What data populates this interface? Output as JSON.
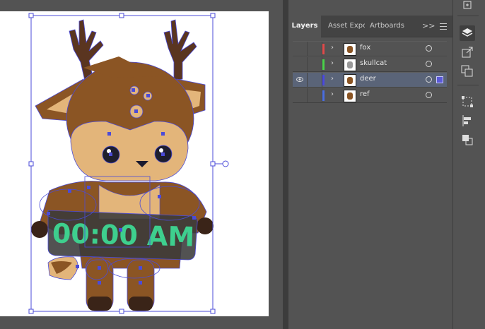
{
  "panel": {
    "tabs": [
      {
        "label": "Layers"
      },
      {
        "label": "Asset Expo"
      },
      {
        "label": "Artboards"
      }
    ],
    "more_label": ">>"
  },
  "layers": [
    {
      "name": "fox",
      "color": "#e04a4a",
      "visible": false,
      "selected": false
    },
    {
      "name": "skullcat",
      "color": "#4ad24a",
      "visible": false,
      "selected": false
    },
    {
      "name": "deer",
      "color": "#4a4ae0",
      "visible": true,
      "selected": true
    },
    {
      "name": "ref",
      "color": "#4a6ee0",
      "visible": false,
      "selected": false
    }
  ],
  "artwork": {
    "clock_text": "00:00 AM",
    "colors": {
      "fur": "#8b5524",
      "antler": "#5a3520",
      "face": "#e3b57a",
      "text": "#3ecf8e",
      "box": "#3a3a3a",
      "selection": "#4b4bd8"
    }
  },
  "toolbar_icons": [
    "export-icon",
    "layers-icon",
    "external-link-icon",
    "duplicate-icon",
    "transform-icon",
    "align-icon",
    "pathfinder-icon"
  ]
}
